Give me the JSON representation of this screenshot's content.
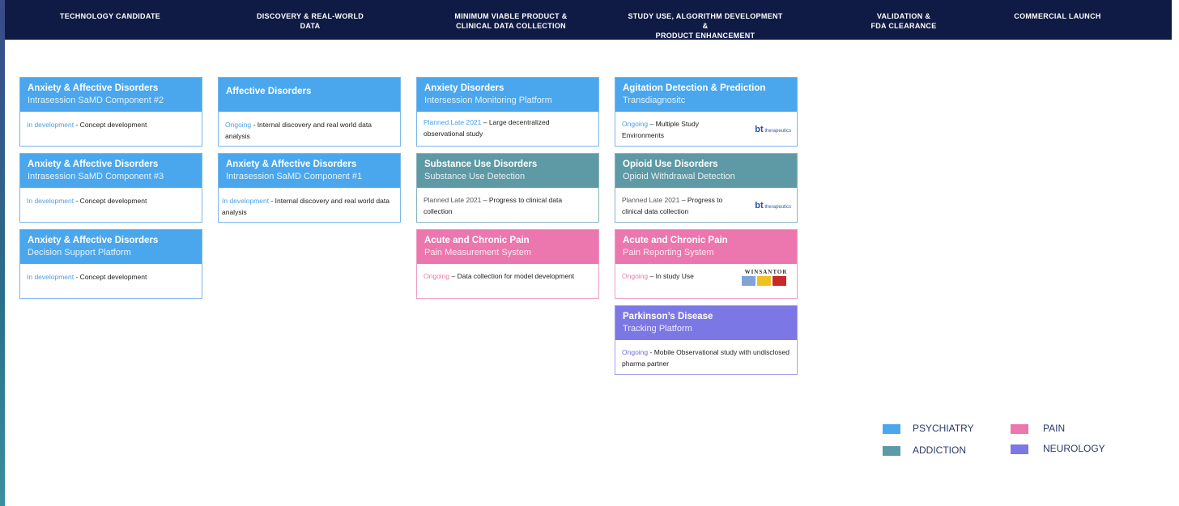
{
  "header": {
    "columns": [
      "TECHNOLOGY CANDIDATE",
      "DISCOVERY  & REAL-WORLD\nDATA",
      "MINIMUM VIABLE PRODUCT  &\nCLINICAL DATA COLLECTION",
      "STUDY USE, ALGORITHM DEVELOPMENT\n&\nPRODUCT  ENHANCEMENT",
      "VALIDATION &\nFDA CLEARANCE",
      "COMMERCIAL LAUNCH"
    ]
  },
  "colors": {
    "psychiatry": "#4aa7ee",
    "addiction": "#5e9aa5",
    "pain": "#ec76ae",
    "neurology": "#7b78e6",
    "header_bg": "#0f1b45"
  },
  "cards": {
    "c1": {
      "title": "Anxiety & Affective Disorders",
      "subtitle": "Intrasession SaMD Component #2",
      "status": "In development",
      "text": " - Concept development"
    },
    "c2": {
      "title": "Anxiety & Affective Disorders",
      "subtitle": "Intrasession SaMD Component #3",
      "status": "In development",
      "text": " - Concept development"
    },
    "c3": {
      "title": "Anxiety & Affective Disorders",
      "subtitle": "Decision Support Platform",
      "status": "In development",
      "text": " - Concept development"
    },
    "c4": {
      "title": "Affective Disorders",
      "subtitle": "",
      "status": "Ongoing",
      "text": " - Internal discovery and real world data analysis"
    },
    "c5": {
      "title": "Anxiety & Affective Disorders",
      "subtitle": "Intrasession SaMD Component #1",
      "status": "In development",
      "text": " - Internal discovery and real world data analysis"
    },
    "c6": {
      "title": "Anxiety Disorders",
      "subtitle": "Intersession Monitoring Platform",
      "status": "Planned  Late 2021",
      "text": " – Large decentralized observational study"
    },
    "c7": {
      "title": "Substance Use Disorders",
      "subtitle": "Substance Use Detection",
      "status": "Planned  Late 2021",
      "text": " – Progress to clinical data collection"
    },
    "c8": {
      "title": "Acute and Chronic Pain",
      "subtitle": "Pain Measurement System",
      "status": "Ongoing",
      "text": " – Data collection  for model development"
    },
    "c9": {
      "title": "Agitation Detection & Prediction",
      "subtitle": "Transdiagnositc",
      "status": "Ongoing",
      "text": " – Multiple  Study Environments",
      "logo": "bt",
      "logo_sub": "therapeutics"
    },
    "c10": {
      "title": "Opioid Use Disorders",
      "subtitle": "Opioid Withdrawal Detection",
      "status": "Planned  Late 2021",
      "text": " – Progress to clinical data  collection",
      "logo": "bt",
      "logo_sub": "therapeutics"
    },
    "c11": {
      "title": "Acute and Chronic Pain",
      "subtitle": "Pain Reporting System",
      "status": "Ongoing",
      "text": " – In study Use",
      "logo": "WINSANTOR"
    },
    "c12": {
      "title": "Parkinson’s Disease",
      "subtitle": "Tracking Platform",
      "status": "Ongoing",
      "text": " - Mobile  Observational study with undisclosed pharma  partner"
    }
  },
  "legend": [
    {
      "label": "PSYCHIATRY",
      "color": "#4aa7ee"
    },
    {
      "label": "PAIN",
      "color": "#ec76ae"
    },
    {
      "label": "ADDICTION",
      "color": "#5e9aa5"
    },
    {
      "label": "NEUROLOGY",
      "color": "#7b78e6"
    }
  ]
}
